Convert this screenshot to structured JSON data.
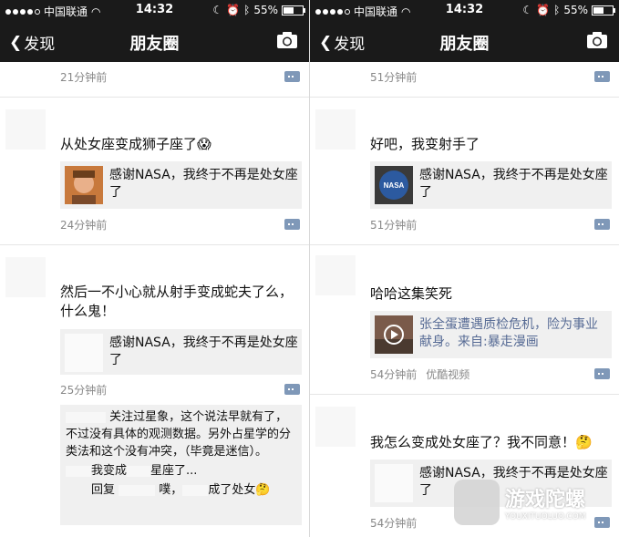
{
  "status": {
    "carrier": "中国联通",
    "time": "14:32",
    "battery": "55%"
  },
  "nav": {
    "back_label": "发现",
    "title": "朋友圈"
  },
  "left": {
    "posts": [
      {
        "time": "21分钟前"
      },
      {
        "text": "从处女座变成狮子座了😱",
        "share_text": "感谢NASA，我终于不再是处女座了",
        "time": "24分钟前"
      },
      {
        "text": "然后一不小心就从射手变成蛇夫了么，什么鬼！",
        "share_text": "感谢NASA，我终于不再是处女座了",
        "time": "25分钟前"
      }
    ],
    "comments": [
      "关注过星象，这个说法早就有了，不过没有具体的观测数据。另外占星学的分类法和这个没有冲突，（毕竟是迷信）。",
      "我变成",
      "星座了...",
      "回复",
      "噗，",
      "成了处女🤔"
    ]
  },
  "right": {
    "posts": [
      {
        "time": "51分钟前"
      },
      {
        "text": "好吧，我变射手了",
        "share_text": "感谢NASA，我终于不再是处女座了",
        "time": "51分钟前",
        "thumb_label": "NASA"
      },
      {
        "text": "哈哈这集笑死",
        "share_text": "张全蛋遭遇质检危机，险为事业献身。来自:暴走漫画",
        "time": "54分钟前",
        "source": "优酷视频"
      },
      {
        "text": "我怎么变成处女座了？我不同意！🤔",
        "share_text": "感谢NASA，我终于不再是处女座了",
        "time": "54分钟前"
      }
    ]
  },
  "watermark": {
    "name": "游戏陀螺",
    "url": "YOUXITUOLUO.COM"
  },
  "colors": {
    "bar": "#1a1a1a",
    "link": "#576b95",
    "comment_btn": "#7f98b8",
    "card": "#f0f0f0"
  }
}
